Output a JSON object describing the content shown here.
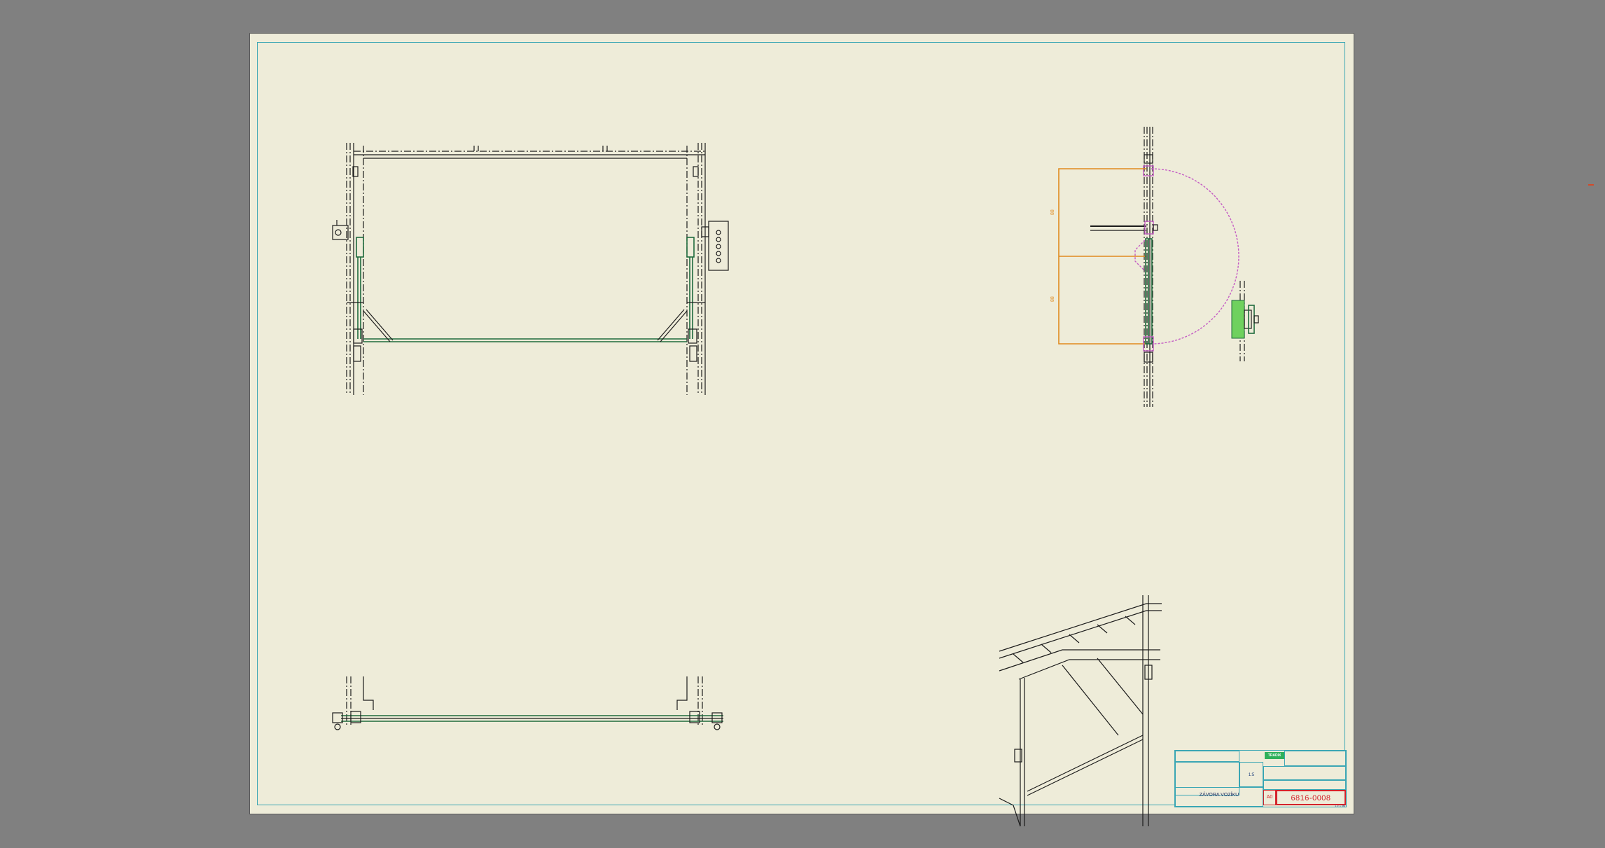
{
  "title_block": {
    "drawing_title": "ZÁVORA VOZÍKU",
    "drawing_number": "6816-0008",
    "format": "A0",
    "company_logo_text": "TRADIX",
    "scale_label": "1:5",
    "sheet_label": "1 z 1 list"
  },
  "dimensions": {
    "upper": "88",
    "lower": "88"
  },
  "colors": {
    "background": "#808080",
    "sheet": "#eeecd9",
    "frame": "#3aa6b4",
    "drawing_number": "#d3242c",
    "logo": "#2fb05a",
    "dimension": "#e08a1e",
    "swing_arc": "#c45cc4",
    "part": "#6fd15e"
  }
}
